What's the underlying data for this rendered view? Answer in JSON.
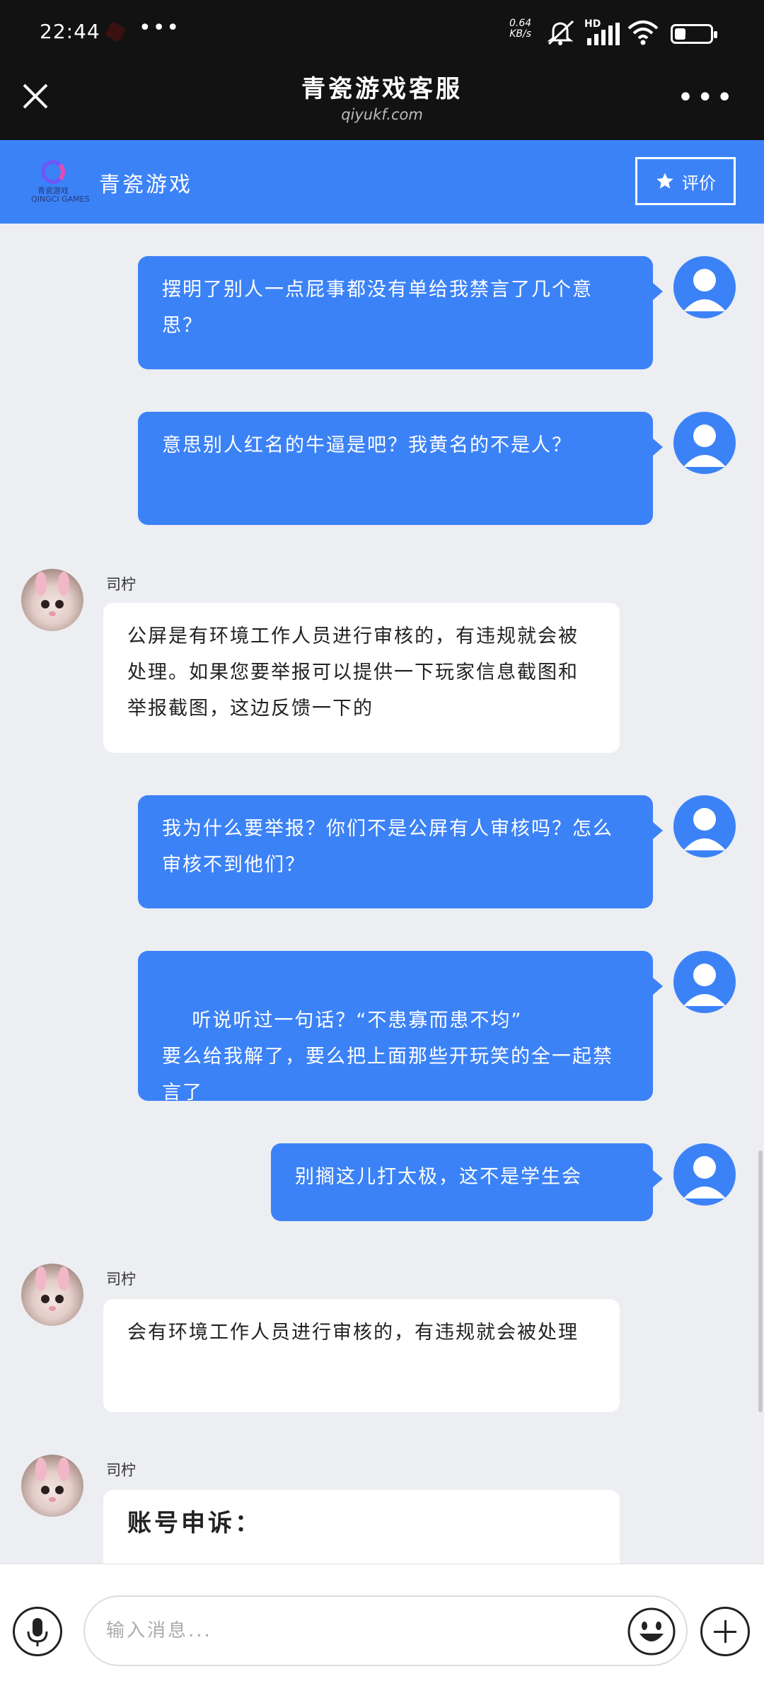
{
  "status_bar": {
    "time": "22:44",
    "overflow_dots": "•••",
    "net_speed": "0.64\nKB/s",
    "hd_label": "HD",
    "battery_level": "31",
    "battery_fraction": 0.31
  },
  "title_bar": {
    "title": "青瓷游戏客服",
    "domain": "qiyukf.com",
    "more": "•••"
  },
  "service_bar": {
    "logo_caption": "青瓷游戏\nQINGCI GAMES",
    "name": "青瓷游戏",
    "rate_label": "评价"
  },
  "messages": [
    {
      "from": "user",
      "text": "摆明了别人一点屁事都没有单给我禁言了几个意思？"
    },
    {
      "from": "user",
      "text": "意思别人红名的牛逼是吧？我黄名的不是人？"
    },
    {
      "from": "agent",
      "name": "司柠",
      "text": "公屏是有环境工作人员进行审核的，有违规就会被处理。如果您要举报可以提供一下玩家信息截图和举报截图，这边反馈一下的"
    },
    {
      "from": "user",
      "text": "我为什么要举报？你们不是公屏有人审核吗？怎么审核不到他们？"
    },
    {
      "from": "user",
      "text": "听说听过一句话？“不患寡而患不均”\n要么给我解了，要么把上面那些开玩笑的全一起禁言了"
    },
    {
      "from": "user",
      "text": "别搁这儿打太极，这不是学生会"
    },
    {
      "from": "agent",
      "name": "司柠",
      "text": "会有环境工作人员进行审核的，有违规就会被处理"
    },
    {
      "from": "agent",
      "name": "司柠",
      "text": "账号申诉："
    }
  ],
  "input": {
    "placeholder": "输入消息..."
  }
}
